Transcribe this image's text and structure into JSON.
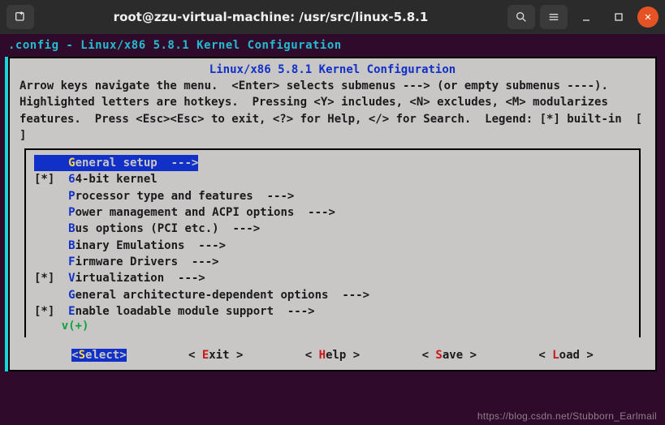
{
  "window": {
    "title": "root@zzu-virtual-machine: /usr/src/linux-5.8.1"
  },
  "term_header": ".config - Linux/x86 5.8.1 Kernel Configuration",
  "box": {
    "title": "Linux/x86 5.8.1 Kernel Configuration",
    "help": "Arrow keys navigate the menu.  <Enter> selects submenus ---> (or empty submenus ----).  Highlighted letters are hotkeys.  Pressing <Y> includes, <N> excludes, <M> modularizes features.  Press <Esc><Esc> to exit, <?> for Help, </> for Search.  Legend: [*] built-in  [ ]"
  },
  "menu": {
    "items": [
      {
        "mark": "    ",
        "hot": "G",
        "rest": "eneral setup  ",
        "arrow": "--->",
        "selected": true
      },
      {
        "mark": "[*] ",
        "hot": "6",
        "rest": "4-bit kernel",
        "arrow": "",
        "selected": false
      },
      {
        "mark": "    ",
        "hot": "P",
        "rest": "rocessor type and features  ",
        "arrow": "--->",
        "selected": false
      },
      {
        "mark": "    ",
        "hot": "P",
        "rest": "ower management and ACPI options  ",
        "arrow": "--->",
        "selected": false
      },
      {
        "mark": "    ",
        "hot": "B",
        "rest": "us options (PCI etc.)  ",
        "arrow": "--->",
        "selected": false
      },
      {
        "mark": "    ",
        "hot": "B",
        "rest": "inary Emulations  ",
        "arrow": "--->",
        "selected": false
      },
      {
        "mark": "    ",
        "hot": "F",
        "rest": "irmware Drivers  ",
        "arrow": "--->",
        "selected": false
      },
      {
        "mark": "[*] ",
        "hot": "V",
        "rest": "irtualization  ",
        "arrow": "--->",
        "selected": false
      },
      {
        "mark": "    ",
        "hot": "G",
        "rest": "eneral architecture-dependent options  ",
        "arrow": "--->",
        "selected": false
      },
      {
        "mark": "[*] ",
        "hot": "E",
        "rest": "nable loadable module support  ",
        "arrow": "--->",
        "selected": false
      }
    ],
    "more": "v(+)"
  },
  "buttons": [
    {
      "pre": "<",
      "hot": "S",
      "post": "elect>",
      "selected": true
    },
    {
      "pre": "< ",
      "hot": "E",
      "post": "xit >",
      "selected": false
    },
    {
      "pre": "< ",
      "hot": "H",
      "post": "elp >",
      "selected": false
    },
    {
      "pre": "< ",
      "hot": "S",
      "post": "ave >",
      "selected": false
    },
    {
      "pre": "< ",
      "hot": "L",
      "post": "oad >",
      "selected": false
    }
  ],
  "watermark": "https://blog.csdn.net/Stubborn_Earlmail"
}
